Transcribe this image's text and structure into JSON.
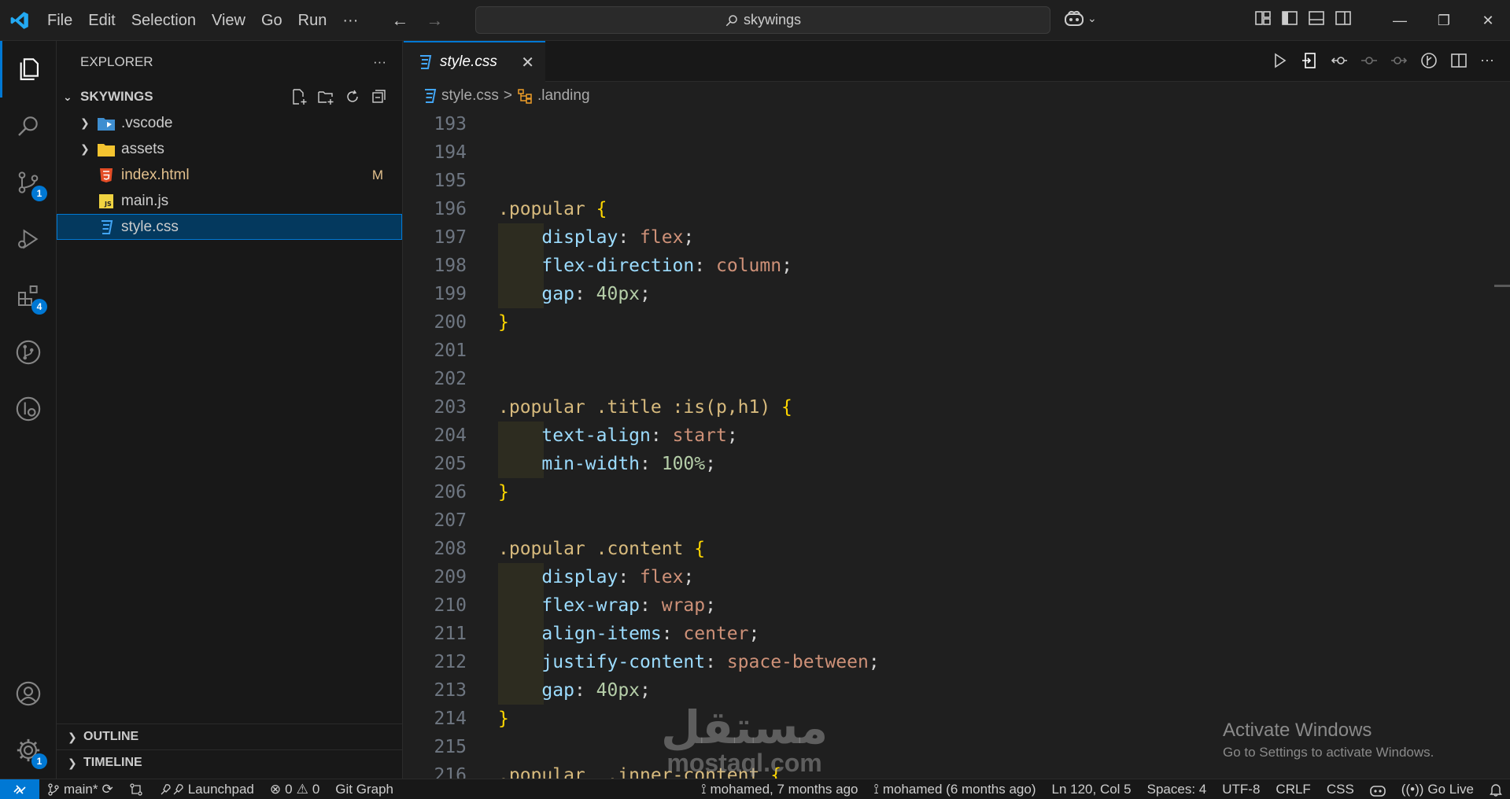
{
  "titlebar": {
    "menu": [
      "File",
      "Edit",
      "Selection",
      "View",
      "Go",
      "Run",
      "···"
    ],
    "search_text": "skywings"
  },
  "activity": {
    "source_control_badge": "1",
    "extensions_badge": "4",
    "settings_badge": "1"
  },
  "sidebar": {
    "title": "EXPLORER",
    "more": "···",
    "folder": "SKYWINGS",
    "items": [
      {
        "label": ".vscode",
        "type": "folder"
      },
      {
        "label": "assets",
        "type": "folder"
      },
      {
        "label": "index.html",
        "type": "html",
        "git": "M"
      },
      {
        "label": "main.js",
        "type": "js"
      },
      {
        "label": "style.css",
        "type": "css"
      }
    ],
    "outline": "OUTLINE",
    "timeline": "TIMELINE"
  },
  "editor": {
    "tab_label": "style.css",
    "tab_close": "✕",
    "breadcrumb_file": "style.css",
    "breadcrumb_sep": ">",
    "breadcrumb_symbol": ".landing",
    "line_numbers": [
      "193",
      "194",
      "195",
      "196",
      "197",
      "198",
      "199",
      "200",
      "201",
      "202",
      "203",
      "204",
      "205",
      "206",
      "207",
      "208",
      "209",
      "210",
      "211",
      "212",
      "213",
      "214",
      "215",
      "216"
    ],
    "lines": {
      "l196_sel": ".popular",
      "l197_prop": "display",
      "l197_val": "flex",
      "l198_prop": "flex-direction",
      "l198_val": "column",
      "l199_prop": "gap",
      "l199_val": "40px",
      "l203_sel": ".popular .title :is(p,h1)",
      "l204_prop": "text-align",
      "l204_val": "start",
      "l205_prop": "min-width",
      "l205_val": "100%",
      "l208_sel": ".popular .content",
      "l209_prop": "display",
      "l209_val": "flex",
      "l210_prop": "flex-wrap",
      "l210_val": "wrap",
      "l211_prop": "align-items",
      "l211_val": "center",
      "l212_prop": "justify-content",
      "l212_val": "space-between",
      "l213_prop": "gap",
      "l213_val": "40px",
      "l216_sel": ".popular  .inner-content"
    }
  },
  "watermarks": {
    "activate_title": "Activate Windows",
    "activate_sub": "Go to Settings to activate Windows.",
    "site_arabic": "مستقل",
    "site_latin": "mostaql.com"
  },
  "statusbar": {
    "branch": "main*",
    "launchpad": "Launchpad",
    "errors": "0",
    "warnings": "0",
    "git_graph": "Git Graph",
    "blame": "mohamed, 7 months ago",
    "commit": "mohamed (6 months ago)",
    "position": "Ln 120, Col 5",
    "spaces": "Spaces: 4",
    "encoding": "UTF-8",
    "eol": "CRLF",
    "language": "CSS",
    "go_live": "Go Live"
  },
  "colors": {
    "accent": "#0078d4",
    "selector": "#d7ba7d",
    "property": "#9cdcfe",
    "value": "#ce9178",
    "number": "#b5cea8",
    "brace": "#ffd700"
  }
}
